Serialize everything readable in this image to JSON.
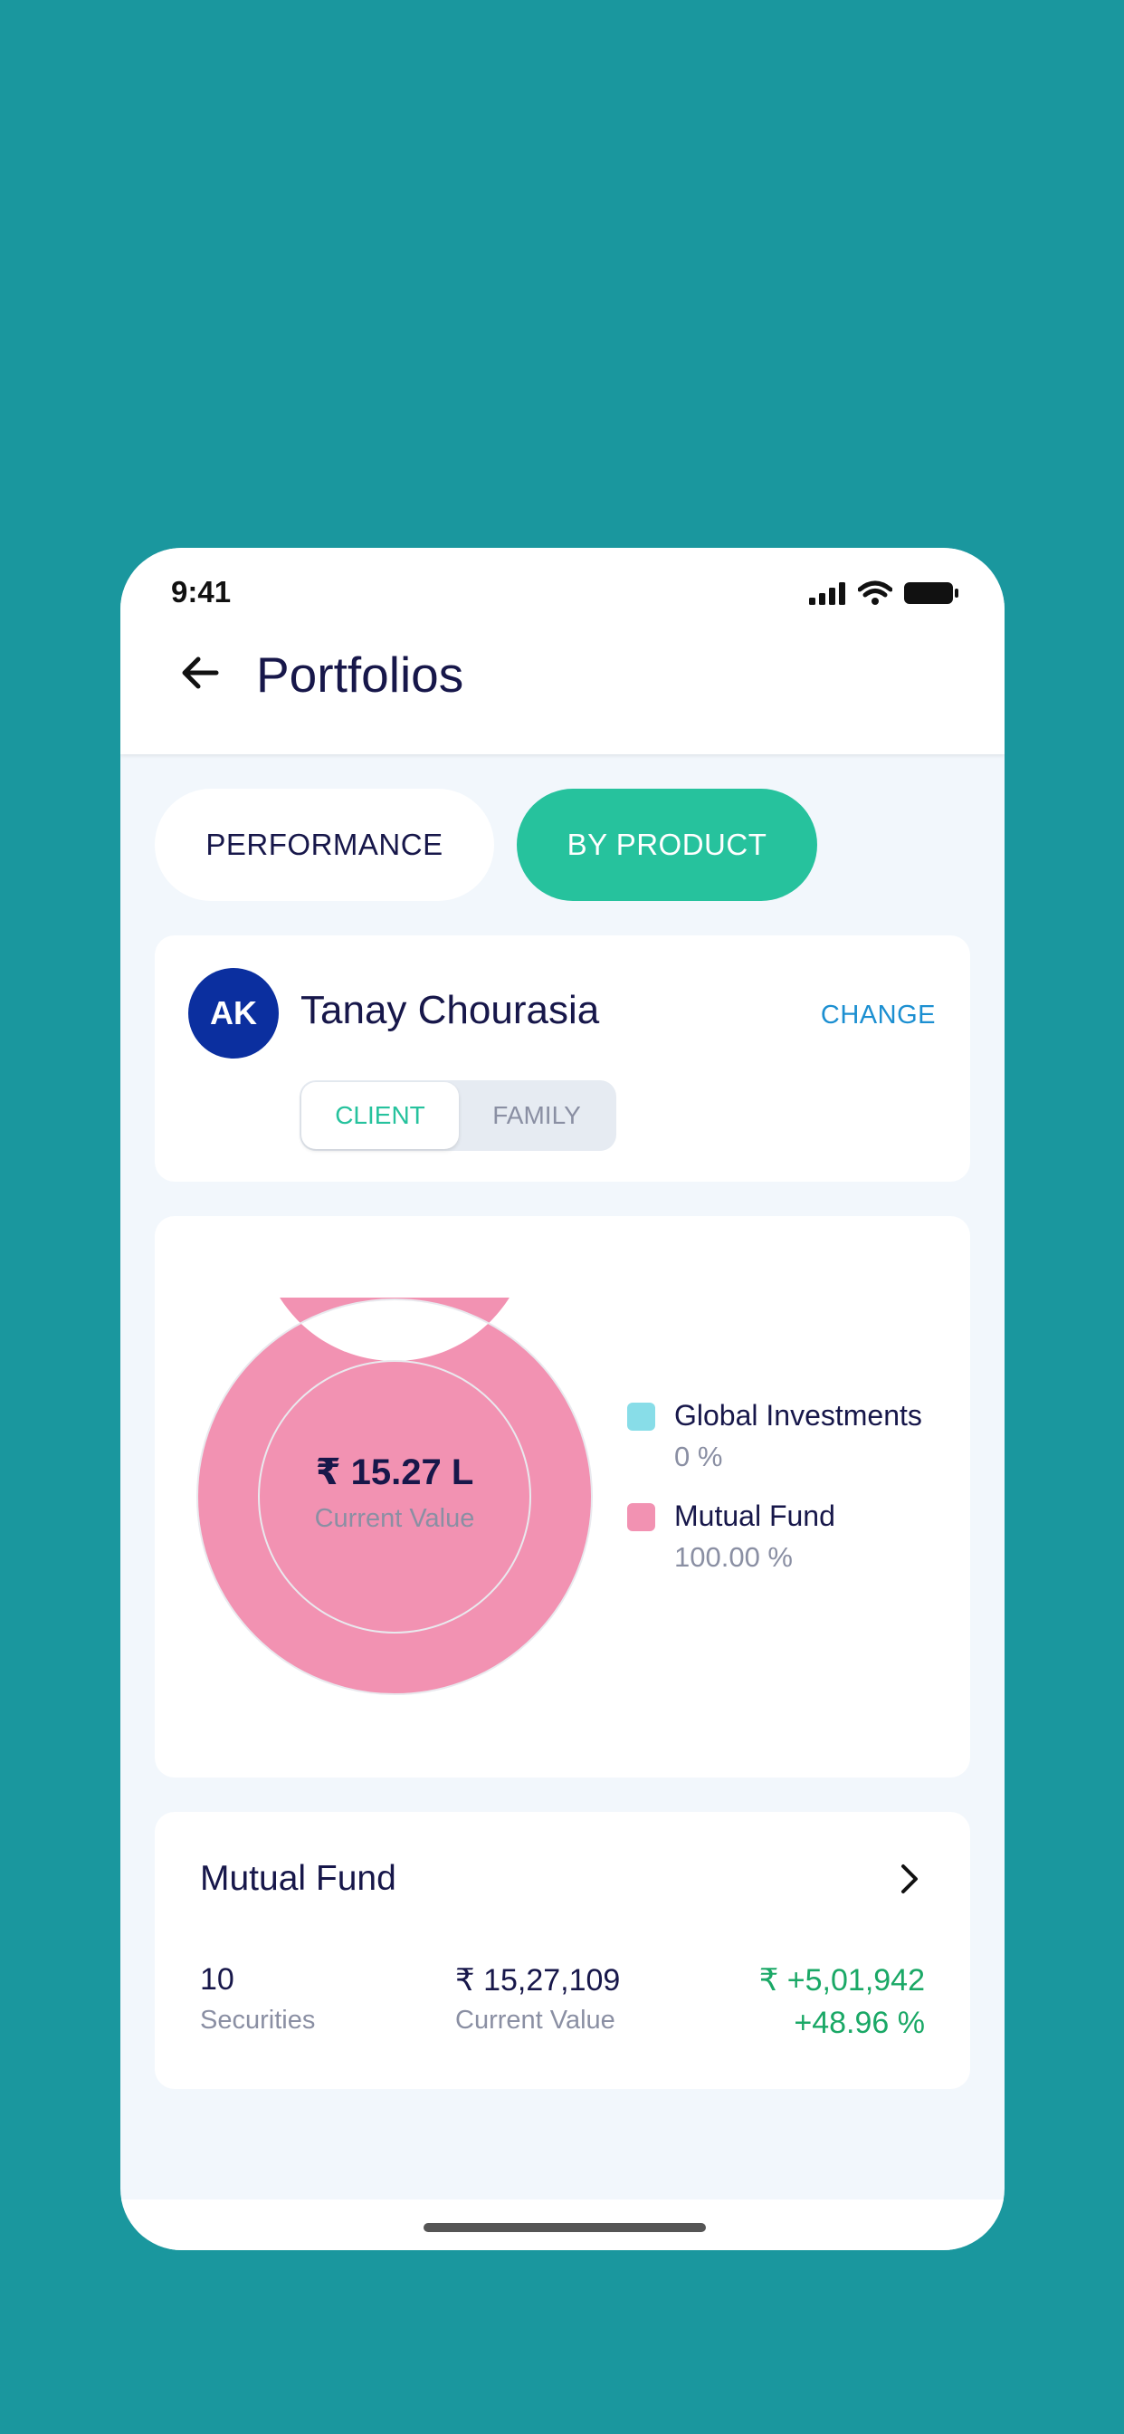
{
  "status_bar": {
    "time": "9:41"
  },
  "header": {
    "title": "Portfolios",
    "back_icon": "arrow-left-icon"
  },
  "view_tabs": [
    {
      "label": "PERFORMANCE",
      "active": false
    },
    {
      "label": "BY PRODUCT",
      "active": true
    }
  ],
  "client_card": {
    "initials": "AK",
    "name": "Tanay Chourasia",
    "change_label": "CHANGE",
    "toggle": {
      "client_label": "CLIENT",
      "family_label": "FAMILY",
      "selected": "CLIENT"
    }
  },
  "allocation": {
    "center_value": "₹ 15.27 L",
    "center_label": "Current Value",
    "legend": [
      {
        "name": "Global Investments",
        "percent_label": "0 %",
        "color": "#88dde8"
      },
      {
        "name": "Mutual Fund",
        "percent_label": "100.00 %",
        "color": "#f292b2"
      }
    ]
  },
  "chart_data": {
    "type": "pie",
    "categories": [
      "Global Investments",
      "Mutual Fund"
    ],
    "values": [
      0,
      100.0
    ],
    "colors": [
      "#88dde8",
      "#f292b2"
    ],
    "donut": true,
    "legend": "right"
  },
  "fund_summary": {
    "title": "Mutual Fund",
    "securities_value": "10",
    "securities_label": "Securities",
    "current_value": "₹ 15,27,109",
    "current_value_label": "Current Value",
    "gain_amount": "₹ +5,01,942",
    "gain_percent": "+48.96 %"
  },
  "colors": {
    "background": "#1a979e",
    "accent_green": "#26c29d",
    "link_blue": "#1c8fd1",
    "avatar_blue": "#0b2f9f",
    "gain_green": "#1aa866"
  }
}
